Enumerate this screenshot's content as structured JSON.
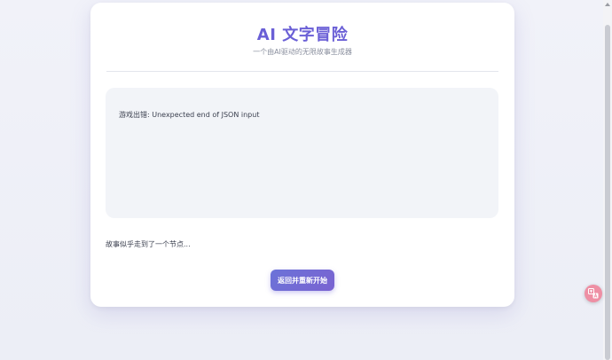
{
  "header": {
    "title": "AI 文字冒险",
    "subtitle": "一个由AI驱动的无限故事生成器"
  },
  "story": {
    "error_text": "游戏出错: Unexpected end of JSON input"
  },
  "prompt": {
    "text": "故事似乎走到了一个节点..."
  },
  "actions": {
    "restart_label": "返回并重新开始"
  },
  "icons": {
    "translate": "translate-icon"
  },
  "colors": {
    "accent": "#6a5fd6",
    "button_start": "#6b73d8",
    "button_end": "#7a63d1",
    "story_bg": "#f2f4f8",
    "translate_fab": "#ee8fa4"
  }
}
